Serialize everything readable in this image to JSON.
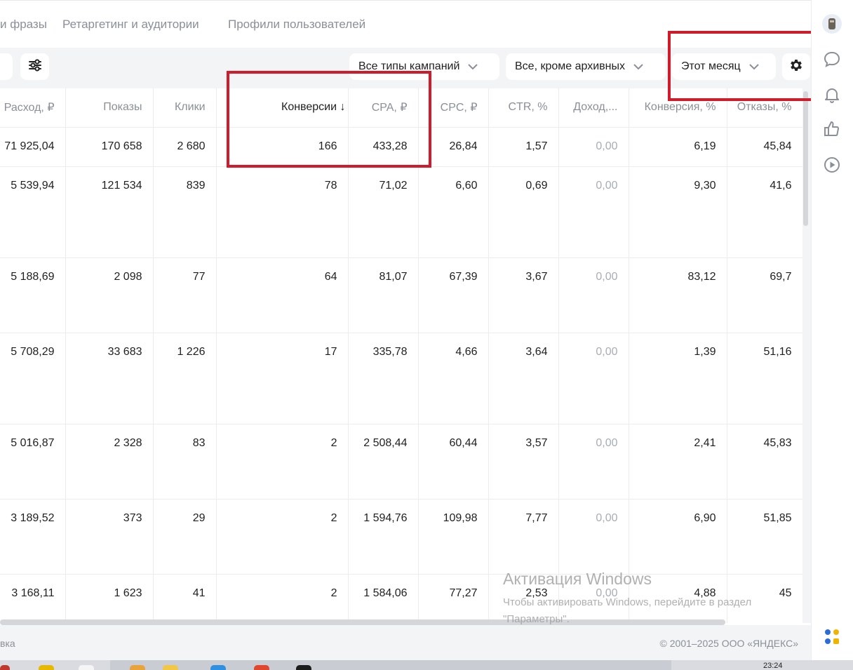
{
  "tabs": [
    "и фразы",
    "Ретаргетинг и аудитории",
    "Профили пользователей"
  ],
  "toolbar": {
    "campaign_type": "Все типы кампаний",
    "status_filter": "Все, кроме архивных",
    "period": "Этот месяц"
  },
  "table": {
    "columns": [
      "Расход, ₽",
      "Показы",
      "Клики",
      "Конверсии ↓",
      "CPA, ₽",
      "CPC, ₽",
      "CTR, %",
      "Доход,...",
      "Конверсия, %",
      "Отказы, %"
    ],
    "rows": [
      [
        "71 925,04",
        "170 658",
        "2 680",
        "166",
        "433,28",
        "26,84",
        "1,57",
        "0,00",
        "6,19",
        "45,84"
      ],
      [
        "5 539,94",
        "121 534",
        "839",
        "78",
        "71,02",
        "6,60",
        "0,69",
        "0,00",
        "9,30",
        "41,6"
      ],
      [
        "5 188,69",
        "2 098",
        "77",
        "64",
        "81,07",
        "67,39",
        "3,67",
        "0,00",
        "83,12",
        "69,7"
      ],
      [
        "5 708,29",
        "33 683",
        "1 226",
        "17",
        "335,78",
        "4,66",
        "3,64",
        "0,00",
        "1,39",
        "51,16"
      ],
      [
        "5 016,87",
        "2 328",
        "83",
        "2",
        "2 508,44",
        "60,44",
        "3,57",
        "0,00",
        "2,41",
        "45,83"
      ],
      [
        "3 189,52",
        "373",
        "29",
        "2",
        "1 594,76",
        "109,98",
        "7,77",
        "0,00",
        "6,90",
        "51,85"
      ],
      [
        "3 168,11",
        "1 623",
        "41",
        "2",
        "1 584,06",
        "77,27",
        "2,53",
        "0,00",
        "4,88",
        "45"
      ]
    ]
  },
  "footer": {
    "left": "вка",
    "right": "© 2001–2025 ООО «ЯНДЕКС»"
  },
  "watermark": {
    "title": "Активация Windows",
    "line1": "Чтобы активировать Windows, перейдите в раздел",
    "line2": "\"Параметры\"."
  },
  "taskbar": {
    "time": "23:24"
  },
  "icons": [
    "sliders-icon",
    "chevron-down-icon",
    "gear-icon",
    "avatar",
    "chat-icon",
    "bell-icon",
    "like-icon",
    "play-icon"
  ]
}
